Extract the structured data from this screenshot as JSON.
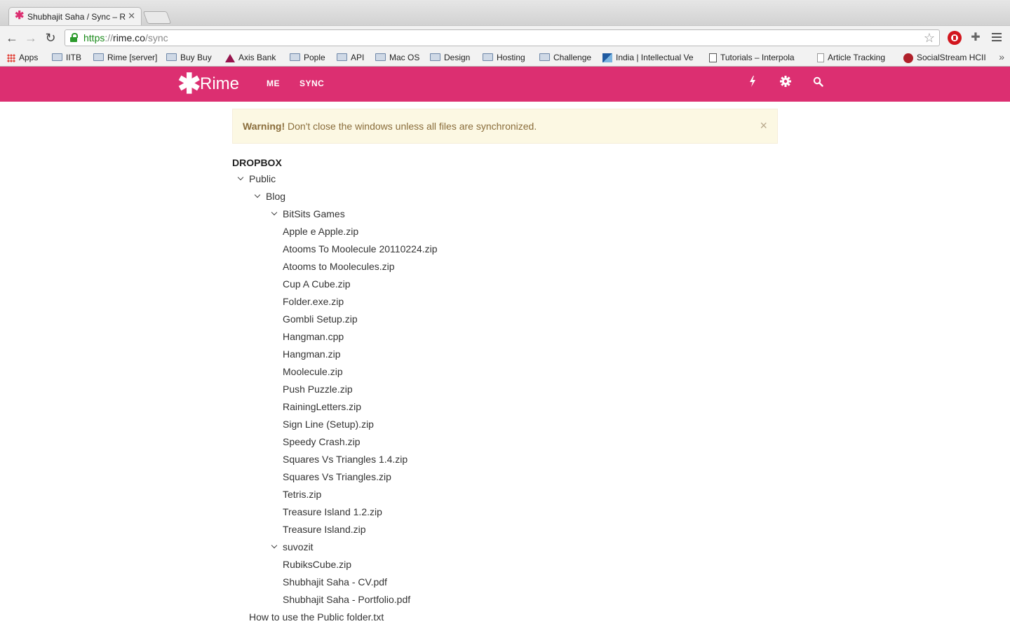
{
  "browser": {
    "tab_title": "Shubhajit Saha / Sync – Rime",
    "url_scheme": "https",
    "url_sep": "://",
    "url_host": "rime.co",
    "url_path": "/sync"
  },
  "bookmarks": [
    {
      "label": "Apps",
      "icon": "apps-icon"
    },
    {
      "label": "IITB",
      "icon": "folder-icon"
    },
    {
      "label": "Rime [server]",
      "icon": "folder-icon"
    },
    {
      "label": "Buy Buy",
      "icon": "folder-icon"
    },
    {
      "label": "Axis Bank",
      "icon": "axis-bank-icon"
    },
    {
      "label": "Pople",
      "icon": "folder-icon"
    },
    {
      "label": "API",
      "icon": "folder-icon"
    },
    {
      "label": "Mac OS",
      "icon": "folder-icon"
    },
    {
      "label": "Design",
      "icon": "folder-icon"
    },
    {
      "label": "Hosting",
      "icon": "folder-icon"
    },
    {
      "label": "Challenge",
      "icon": "folder-icon"
    },
    {
      "label": "India | Intellectual Ve",
      "icon": "india-icon"
    },
    {
      "label": "Tutorials – Interpola",
      "icon": "tutorials-icon"
    },
    {
      "label": "Article Tracking",
      "icon": "page-icon"
    },
    {
      "label": "SocialStream HCII",
      "icon": "hcii-icon"
    }
  ],
  "bookmarks_more": "»",
  "header": {
    "brand": "Rime",
    "nav": [
      "ME",
      "SYNC"
    ],
    "brand_color": "#dc2f71"
  },
  "alert": {
    "strong": "Warning!",
    "text": " Don't close the windows unless all files are synchronized.",
    "close": "×"
  },
  "tree": {
    "root": "DROPBOX",
    "nodes": [
      {
        "label": "Public",
        "depth": 1,
        "expanded": true
      },
      {
        "label": "Blog",
        "depth": 2,
        "expanded": true
      },
      {
        "label": "BitSits Games",
        "depth": 3,
        "expanded": true
      },
      {
        "label": "Apple e Apple.zip",
        "depth": 3
      },
      {
        "label": "Atooms To Moolecule 20110224.zip",
        "depth": 3
      },
      {
        "label": "Atooms to Moolecules.zip",
        "depth": 3
      },
      {
        "label": "Cup A Cube.zip",
        "depth": 3
      },
      {
        "label": "Folder.exe.zip",
        "depth": 3
      },
      {
        "label": "Gombli Setup.zip",
        "depth": 3
      },
      {
        "label": "Hangman.cpp",
        "depth": 3
      },
      {
        "label": "Hangman.zip",
        "depth": 3
      },
      {
        "label": "Moolecule.zip",
        "depth": 3
      },
      {
        "label": "Push Puzzle.zip",
        "depth": 3
      },
      {
        "label": "RainingLetters.zip",
        "depth": 3
      },
      {
        "label": "Sign Line (Setup).zip",
        "depth": 3
      },
      {
        "label": "Speedy Crash.zip",
        "depth": 3
      },
      {
        "label": "Squares Vs Triangles 1.4.zip",
        "depth": 3
      },
      {
        "label": "Squares Vs Triangles.zip",
        "depth": 3
      },
      {
        "label": "Tetris.zip",
        "depth": 3
      },
      {
        "label": "Treasure Island 1.2.zip",
        "depth": 3
      },
      {
        "label": "Treasure Island.zip",
        "depth": 3
      },
      {
        "label": "suvozit",
        "depth": 3,
        "expanded": true
      },
      {
        "label": "RubiksCube.zip",
        "depth": 3
      },
      {
        "label": "Shubhajit Saha - CV.pdf",
        "depth": 3
      },
      {
        "label": "Shubhajit Saha - Portfolio.pdf",
        "depth": 3
      },
      {
        "label": "How to use the Public folder.txt",
        "depth": 1
      }
    ]
  }
}
